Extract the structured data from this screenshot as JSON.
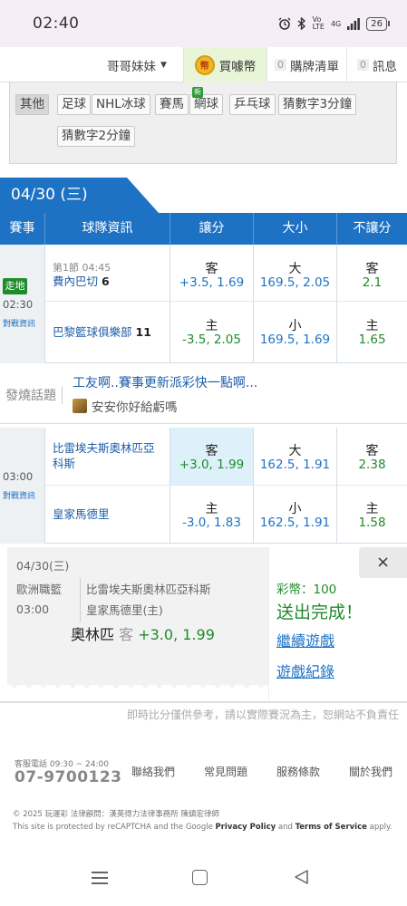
{
  "status_bar": {
    "time": "02:40",
    "icons": [
      "alarm-icon",
      "bluetooth-icon",
      "volte-icon",
      "signal-icon"
    ],
    "network": "4G",
    "battery": "26"
  },
  "top_nav": {
    "user": "哥哥妹妹",
    "coin_label": "買噱幣",
    "cart_count": "0",
    "cart_label": "購牌清單",
    "msg_count": "0",
    "msg_label": "訊息"
  },
  "categories": {
    "items": [
      "其他",
      "足球",
      "NHL冰球",
      "賽馬",
      "網球",
      "乒乓球",
      "猜數字3分鐘",
      "猜數字2分鐘"
    ],
    "new_tag": "新"
  },
  "date_header": "04/30 (三)",
  "table_header": [
    "賽事",
    "球隊資訊",
    "讓分",
    "大小",
    "不讓分"
  ],
  "games": [
    {
      "live": "走地",
      "time": "02:30",
      "battle_info": "對戰資訊",
      "period": "第1節 04:45",
      "away_team": "費內巴切",
      "away_score": "6",
      "home_team": "巴黎籃球俱樂部",
      "home_score": "11",
      "away_spread_side": "客",
      "away_spread": "+3.5, 1.69",
      "away_total_side": "大",
      "away_total": "169.5, 2.05",
      "away_ml_side": "客",
      "away_ml": "2.1",
      "home_spread_side": "主",
      "home_spread": "-3.5, 2.05",
      "home_total_side": "小",
      "home_total": "169.5, 1.69",
      "home_ml_side": "主",
      "home_ml": "1.65"
    },
    {
      "time": "03:00",
      "battle_info": "對戰資訊",
      "away_team": "比雷埃夫斯奧林匹亞科斯",
      "home_team": "皇家馬德里",
      "away_spread_side": "客",
      "away_spread": "+3.0, 1.99",
      "away_total_side": "大",
      "away_total": "162.5, 1.91",
      "away_ml_side": "客",
      "away_ml": "2.38",
      "home_spread_side": "主",
      "home_spread": "-3.0, 1.83",
      "home_total_side": "小",
      "home_total": "162.5, 1.91",
      "home_ml_side": "主",
      "home_ml": "1.58"
    }
  ],
  "hot_topic": {
    "label": "發燒話題",
    "title": "工友啊..賽事更新派彩快一點啊...",
    "subtitle": "安安你好給虧嗎"
  },
  "bet_popup": {
    "date": "04/30(三)",
    "league": "歐洲職籃",
    "time": "03:00",
    "team1": "比雷埃夫斯奧林匹亞科斯",
    "team2": "皇家馬德里(主)",
    "pick_team": "奧林匹",
    "pick_side": "客",
    "pick_line": "+3.0, 1.99",
    "coin_text": "彩幣：100",
    "done_text": "送出完成！",
    "continue_link": "繼續遊戲",
    "history_link": "遊戲紀錄",
    "close": "×"
  },
  "footer": {
    "disclaimer": "即時比分僅供參考，請以實際賽況為主，恕網站不負責任",
    "cs_label": "客服電話 09:30 ~ 24:00",
    "cs_phone": "07-9700123",
    "links": [
      "聯絡我們",
      "常見問題",
      "服務條款",
      "關於我們"
    ],
    "copyright": "© 2025 玩運彩 法律顧問：漢英得力法律事務所 陳鎮宏律師",
    "recaptcha_pre": "This site is protected by reCAPTCHA and the Google ",
    "privacy": "Privacy Policy",
    "and": " and ",
    "terms": "Terms of Service",
    "apply": " apply."
  }
}
